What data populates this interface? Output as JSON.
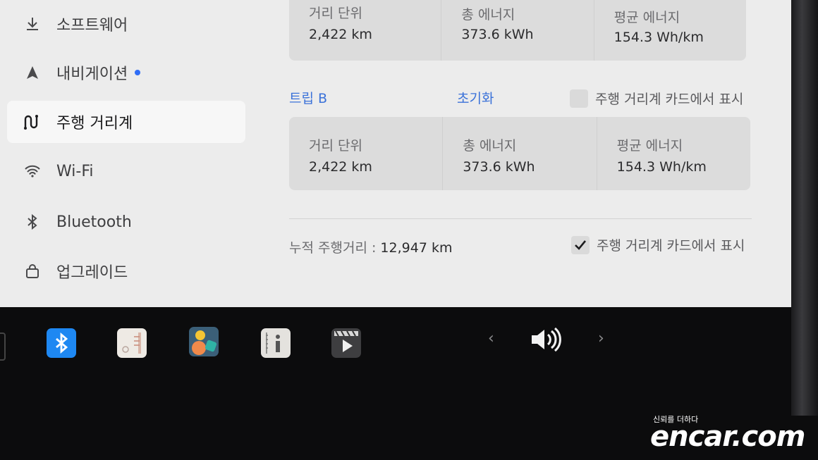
{
  "sidebar": {
    "items": [
      {
        "label": "소프트웨어",
        "icon": "download-icon",
        "active": false,
        "notify": false
      },
      {
        "label": "내비게이션",
        "icon": "navigation-arrow-icon",
        "active": false,
        "notify": true
      },
      {
        "label": "주행 거리계",
        "icon": "odometer-route-icon",
        "active": true,
        "notify": false
      },
      {
        "label": "Wi-Fi",
        "icon": "wifi-icon",
        "active": false,
        "notify": false
      },
      {
        "label": "Bluetooth",
        "icon": "bluetooth-icon",
        "active": false,
        "notify": false
      },
      {
        "label": "업그레이드",
        "icon": "shopping-bag-icon",
        "active": false,
        "notify": false
      }
    ]
  },
  "trip_a": {
    "distance_label": "거리 단위",
    "distance_value": "2,422 km",
    "energy_label": "총 에너지",
    "energy_value": "373.6 kWh",
    "avg_label": "평균 에너지",
    "avg_value": "154.3 Wh/km"
  },
  "trip_b": {
    "title": "트립 B",
    "reset_label": "초기화",
    "show_on_card_label": "주행 거리계 카드에서 표시",
    "show_on_card_checked": false,
    "distance_label": "거리 단위",
    "distance_value": "2,422 km",
    "energy_label": "총 에너지",
    "energy_value": "373.6 kWh",
    "avg_label": "평균 에너지",
    "avg_value": "154.3 Wh/km"
  },
  "odometer": {
    "label": "누적 주행거리 :",
    "value": "12,947 km",
    "show_on_card_label": "주행 거리계 카드에서 표시",
    "show_on_card_checked": true
  },
  "dock": {
    "apps": [
      "bluetooth-app-icon",
      "notepad-app-icon",
      "photo-gallery-app-icon",
      "manual-info-app-icon",
      "video-player-app-icon"
    ],
    "prev_glyph": "‹",
    "next_glyph": "›",
    "volume_icon": "volume-icon"
  },
  "watermark": {
    "tagline": "신뢰를 더하다",
    "brand": "encar.com"
  },
  "colors": {
    "accent": "#3b72d9",
    "notify_dot": "#2f6df6",
    "screen_bg": "#ececec",
    "card_bg": "#dcdcdc"
  }
}
